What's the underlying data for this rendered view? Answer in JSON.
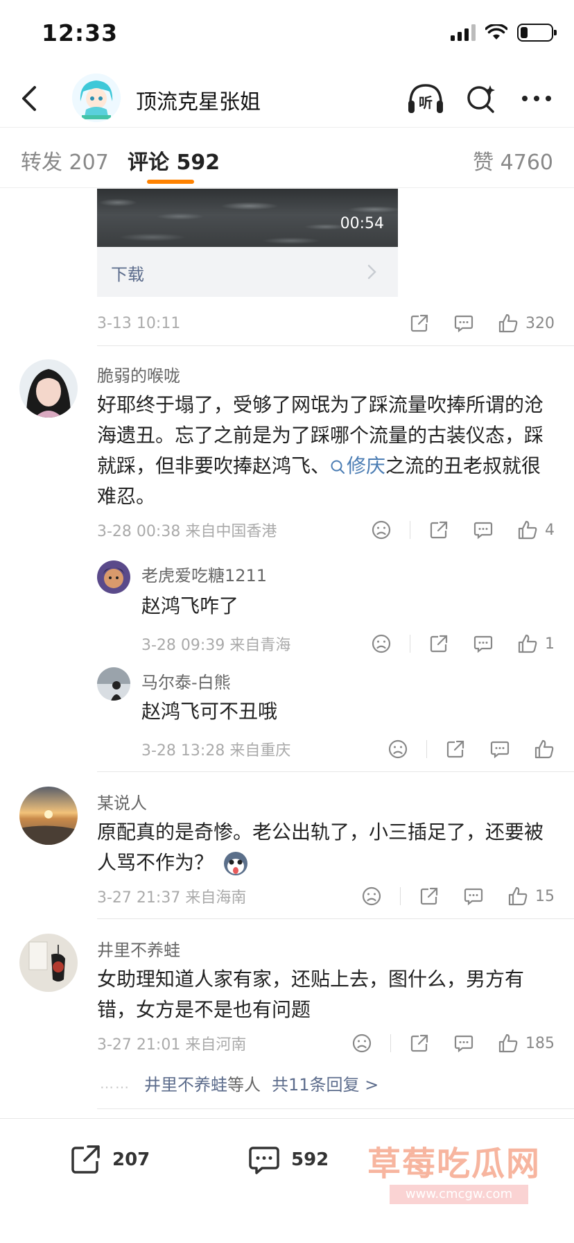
{
  "status_bar": {
    "time": "12:33"
  },
  "nav": {
    "title": "顶流克星张姐",
    "listen_label": "听"
  },
  "tabs": [
    {
      "label": "转发",
      "count": "207"
    },
    {
      "label": "评论",
      "count": "592"
    },
    {
      "label": "赞",
      "count": "4760"
    }
  ],
  "video": {
    "duration": "00:54",
    "download_label": "下载"
  },
  "post_meta": {
    "date": "3-13 10:11",
    "likes": "320"
  },
  "comments": [
    {
      "name": "脆弱的喉咙",
      "text_before": "好耶终于塌了，受够了网氓为了踩流量吹捧所谓的沧海遗丑。忘了之前是为了踩哪个流量的古装仪态，踩就踩，但非要吹捧赵鸿飞、",
      "mention": "修庆",
      "text_after": "之流的丑老叔就很难忍。",
      "meta": "3-28 00:38  来自中国香港",
      "likes": "4",
      "replies": [
        {
          "name": "老虎爱吃糖1211",
          "text": "赵鸿飞咋了",
          "meta": "3-28 09:39  来自青海",
          "likes": "1"
        },
        {
          "name": "马尔泰-白熊",
          "text": "赵鸿飞可不丑哦",
          "meta": "3-28 13:28  来自重庆",
          "likes": ""
        }
      ]
    },
    {
      "name": "某说人",
      "text": "原配真的是奇惨。老公出轨了，小三插足了，还要被人骂不作为？",
      "meta": "3-27 21:37  来自海南",
      "likes": "15"
    },
    {
      "name": "井里不养蛙",
      "text": "女助理知道人家有家，还贴上去，图什么，男方有错，女方是不是也有问题",
      "meta": "3-27 21:01  来自河南",
      "likes": "185",
      "reply_summary": {
        "dots": "……",
        "name": "井里不养蛙",
        "suffix": "等人",
        "total": "共11条回复 >"
      }
    }
  ],
  "bottom_bar": {
    "repost_count": "207",
    "comment_count": "592"
  },
  "watermark": {
    "main": "草莓吃瓜网",
    "sub": "www.cmcgw.com"
  },
  "colors": {
    "accent": "#ff8200",
    "link": "#4a7cb3",
    "muted": "#aaaaaa"
  }
}
